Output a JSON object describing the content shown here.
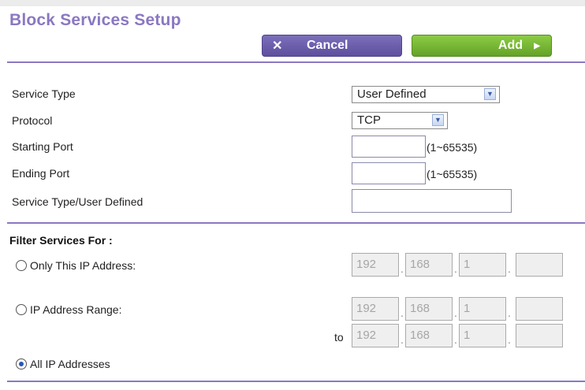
{
  "page": {
    "title": "Block Services Setup"
  },
  "buttons": {
    "cancel_label": "Cancel",
    "add_label": "Add"
  },
  "form": {
    "service_type": {
      "label": "Service Type",
      "value": "User Defined"
    },
    "protocol": {
      "label": "Protocol",
      "value": "TCP"
    },
    "starting_port": {
      "label": "Starting Port",
      "value": "",
      "hint": "(1~65535)"
    },
    "ending_port": {
      "label": "Ending Port",
      "value": "",
      "hint": "(1~65535)"
    },
    "service_user_defined": {
      "label": "Service Type/User Defined",
      "value": ""
    }
  },
  "filter": {
    "heading": "Filter Services For :",
    "only_ip": {
      "label": "Only This IP Address:",
      "selected": false,
      "octets": [
        "192",
        "168",
        "1",
        ""
      ]
    },
    "ip_range": {
      "label": "IP Address Range:",
      "selected": false,
      "start": [
        "192",
        "168",
        "1",
        ""
      ],
      "to_label": "to",
      "end": [
        "192",
        "168",
        "1",
        ""
      ]
    },
    "all_ip": {
      "label": "All IP Addresses",
      "selected": true
    }
  },
  "colors": {
    "accent": "#8a78c2",
    "cancel": "#5e4f9e",
    "add": "#6aaa2c",
    "radio_dot": "#2a56b4"
  }
}
